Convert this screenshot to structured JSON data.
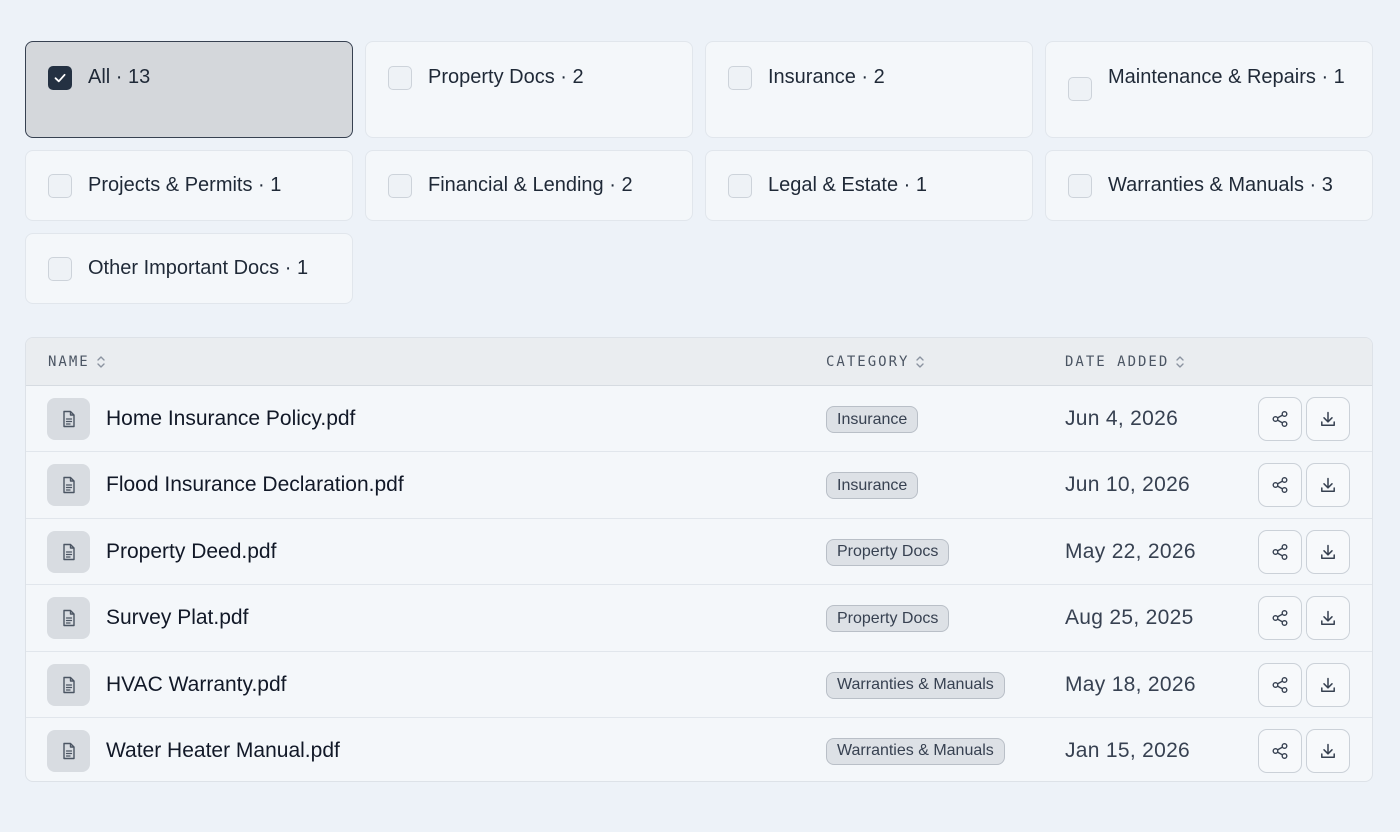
{
  "filters": [
    {
      "label": "All · 13",
      "checked": true
    },
    {
      "label": "Property Docs · 2",
      "checked": false
    },
    {
      "label": "Insurance · 2",
      "checked": false
    },
    {
      "label": "Maintenance & Repairs · 1",
      "checked": false
    },
    {
      "label": "Projects & Permits · 1",
      "checked": false
    },
    {
      "label": "Financial & Lending · 2",
      "checked": false
    },
    {
      "label": "Legal & Estate · 1",
      "checked": false
    },
    {
      "label": "Warranties & Manuals · 3",
      "checked": false
    },
    {
      "label": "Other Important Docs · 1",
      "checked": false
    }
  ],
  "table": {
    "headers": {
      "name": "NAME",
      "category": "CATEGORY",
      "date": "DATE ADDED"
    },
    "rows": [
      {
        "name": "Home Insurance Policy.pdf",
        "category": "Insurance",
        "date": "Jun 4, 2026"
      },
      {
        "name": "Flood Insurance Declaration.pdf",
        "category": "Insurance",
        "date": "Jun 10, 2026"
      },
      {
        "name": "Property Deed.pdf",
        "category": "Property Docs",
        "date": "May 22, 2026"
      },
      {
        "name": "Survey Plat.pdf",
        "category": "Property Docs",
        "date": "Aug 25, 2025"
      },
      {
        "name": "HVAC Warranty.pdf",
        "category": "Warranties & Manuals",
        "date": "May 18, 2026"
      },
      {
        "name": "Water Heater Manual.pdf",
        "category": "Warranties & Manuals",
        "date": "Jan 15, 2026"
      }
    ],
    "row_icons": {
      "file": "document-icon",
      "share": "share-icon",
      "download": "download-icon"
    }
  },
  "icons": {
    "check": "checkmark-icon",
    "sort": "sort-icon"
  }
}
